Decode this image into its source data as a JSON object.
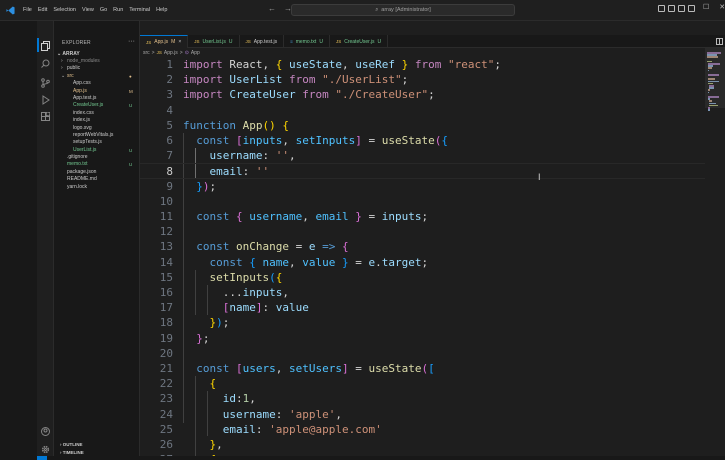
{
  "titlebar": {
    "menu": [
      "File",
      "Edit",
      "Selection",
      "View",
      "Go",
      "Run",
      "Terminal",
      "Help"
    ],
    "search_text": "array [Administrator]",
    "nav_back": "←",
    "nav_forward": "→"
  },
  "sidebar": {
    "title": "EXPLORER",
    "root": "ARRAY",
    "tree": [
      {
        "label": "node_modules",
        "indent": 1,
        "kind": "folder",
        "badge": "",
        "color": "#8a8a8a"
      },
      {
        "label": "public",
        "indent": 1,
        "kind": "folder",
        "badge": "",
        "color": "#cccccc"
      },
      {
        "label": "src",
        "indent": 1,
        "kind": "folder-open",
        "badge": "●",
        "color": "#e2c08d"
      },
      {
        "label": "App.css",
        "indent": 2,
        "kind": "file",
        "badge": "",
        "color": "#cccccc"
      },
      {
        "label": "App.js",
        "indent": 2,
        "kind": "file",
        "badge": "M",
        "color": "#e2c08d"
      },
      {
        "label": "App.test.js",
        "indent": 2,
        "kind": "file",
        "badge": "",
        "color": "#cccccc"
      },
      {
        "label": "CreateUser.js",
        "indent": 2,
        "kind": "file",
        "badge": "U",
        "color": "#73c991"
      },
      {
        "label": "index.css",
        "indent": 2,
        "kind": "file",
        "badge": "",
        "color": "#cccccc"
      },
      {
        "label": "index.js",
        "indent": 2,
        "kind": "file",
        "badge": "",
        "color": "#cccccc"
      },
      {
        "label": "logo.svg",
        "indent": 2,
        "kind": "file",
        "badge": "",
        "color": "#cccccc"
      },
      {
        "label": "reportWebVitals.js",
        "indent": 2,
        "kind": "file",
        "badge": "",
        "color": "#cccccc"
      },
      {
        "label": "setupTests.js",
        "indent": 2,
        "kind": "file",
        "badge": "",
        "color": "#cccccc"
      },
      {
        "label": "UserList.js",
        "indent": 2,
        "kind": "file",
        "badge": "U",
        "color": "#73c991"
      },
      {
        "label": ".gitignore",
        "indent": 1,
        "kind": "file",
        "badge": "",
        "color": "#cccccc"
      },
      {
        "label": "memo.txt",
        "indent": 1,
        "kind": "file",
        "badge": "U",
        "color": "#73c991"
      },
      {
        "label": "package.json",
        "indent": 1,
        "kind": "file",
        "badge": "",
        "color": "#cccccc"
      },
      {
        "label": "README.md",
        "indent": 1,
        "kind": "file",
        "badge": "",
        "color": "#cccccc"
      },
      {
        "label": "yarn.lock",
        "indent": 1,
        "kind": "file",
        "badge": "",
        "color": "#cccccc"
      }
    ],
    "outline": "OUTLINE",
    "timeline": "TIMELINE"
  },
  "tabs": [
    {
      "label": "App.js",
      "status": "M",
      "icon": "JS",
      "active": true,
      "color": "#e2c08d"
    },
    {
      "label": "UserList.js",
      "status": "U",
      "icon": "JS",
      "active": false,
      "color": "#73c991"
    },
    {
      "label": "App.test.js",
      "status": "",
      "icon": "JS",
      "active": false,
      "color": "#cccccc"
    },
    {
      "label": "memo.txt",
      "status": "U",
      "icon": "≡",
      "active": false,
      "color": "#73c991"
    },
    {
      "label": "CreateUser.js",
      "status": "U",
      "icon": "JS",
      "active": false,
      "color": "#73c991"
    }
  ],
  "breadcrumb": {
    "folder": "src",
    "sep": ">",
    "file": "App.js",
    "symbol": "App"
  },
  "editor": {
    "current_line": 8,
    "lines": [
      {
        "n": "1",
        "tokens": [
          [
            "kw2",
            "import"
          ],
          [
            "pl",
            " React, "
          ],
          [
            "b1",
            "{"
          ],
          [
            "pl",
            " "
          ],
          [
            "var",
            "useState"
          ],
          [
            "pl",
            ", "
          ],
          [
            "var",
            "useRef"
          ],
          [
            "pl",
            " "
          ],
          [
            "b1",
            "}"
          ],
          [
            "pl",
            " "
          ],
          [
            "kw2",
            "from"
          ],
          [
            "pl",
            " "
          ],
          [
            "str",
            "\"react\""
          ],
          [
            "pl",
            ";"
          ]
        ]
      },
      {
        "n": "2",
        "tokens": [
          [
            "kw2",
            "import"
          ],
          [
            "pl",
            " "
          ],
          [
            "var",
            "UserList"
          ],
          [
            "pl",
            " "
          ],
          [
            "kw2",
            "from"
          ],
          [
            "pl",
            " "
          ],
          [
            "str",
            "\"./UserList\""
          ],
          [
            "pl",
            ";"
          ]
        ]
      },
      {
        "n": "3",
        "tokens": [
          [
            "kw2",
            "import"
          ],
          [
            "pl",
            " "
          ],
          [
            "var",
            "CreateUser"
          ],
          [
            "pl",
            " "
          ],
          [
            "kw2",
            "from"
          ],
          [
            "pl",
            " "
          ],
          [
            "str",
            "\"./CreateUser\""
          ],
          [
            "pl",
            ";"
          ]
        ]
      },
      {
        "n": "4",
        "tokens": []
      },
      {
        "n": "5",
        "tokens": [
          [
            "kw",
            "function"
          ],
          [
            "pl",
            " "
          ],
          [
            "fn",
            "App"
          ],
          [
            "b1",
            "()"
          ],
          [
            "pl",
            " "
          ],
          [
            "b1",
            "{"
          ]
        ]
      },
      {
        "n": "6",
        "tokens": [
          [
            "pl",
            "  "
          ],
          [
            "kw",
            "const"
          ],
          [
            "pl",
            " "
          ],
          [
            "b2",
            "["
          ],
          [
            "cst",
            "inputs"
          ],
          [
            "pl",
            ", "
          ],
          [
            "cst",
            "setInputs"
          ],
          [
            "b2",
            "]"
          ],
          [
            "pl",
            " = "
          ],
          [
            "fn",
            "useState"
          ],
          [
            "b2",
            "("
          ],
          [
            "b3",
            "{"
          ]
        ]
      },
      {
        "n": "7",
        "tokens": [
          [
            "pl",
            "    "
          ],
          [
            "var",
            "username"
          ],
          [
            "pl",
            ": "
          ],
          [
            "str",
            "''"
          ],
          [
            "pl",
            ","
          ]
        ]
      },
      {
        "n": "8",
        "tokens": [
          [
            "pl",
            "    "
          ],
          [
            "var",
            "email"
          ],
          [
            "pl",
            ": "
          ],
          [
            "str",
            "''"
          ]
        ]
      },
      {
        "n": "9",
        "tokens": [
          [
            "pl",
            "  "
          ],
          [
            "b3",
            "}"
          ],
          [
            "b2",
            ")"
          ],
          [
            "pl",
            ";"
          ]
        ]
      },
      {
        "n": "10",
        "tokens": []
      },
      {
        "n": "11",
        "tokens": [
          [
            "pl",
            "  "
          ],
          [
            "kw",
            "const"
          ],
          [
            "pl",
            " "
          ],
          [
            "b2",
            "{"
          ],
          [
            "pl",
            " "
          ],
          [
            "cst",
            "username"
          ],
          [
            "pl",
            ", "
          ],
          [
            "cst",
            "email"
          ],
          [
            "pl",
            " "
          ],
          [
            "b2",
            "}"
          ],
          [
            "pl",
            " = "
          ],
          [
            "var",
            "inputs"
          ],
          [
            "pl",
            ";"
          ]
        ]
      },
      {
        "n": "12",
        "tokens": []
      },
      {
        "n": "13",
        "tokens": [
          [
            "pl",
            "  "
          ],
          [
            "kw",
            "const"
          ],
          [
            "pl",
            " "
          ],
          [
            "fn",
            "onChange"
          ],
          [
            "pl",
            " = "
          ],
          [
            "var",
            "e"
          ],
          [
            "pl",
            " "
          ],
          [
            "kw",
            "=>"
          ],
          [
            "pl",
            " "
          ],
          [
            "b2",
            "{"
          ]
        ]
      },
      {
        "n": "14",
        "tokens": [
          [
            "pl",
            "    "
          ],
          [
            "kw",
            "const"
          ],
          [
            "pl",
            " "
          ],
          [
            "b3",
            "{"
          ],
          [
            "pl",
            " "
          ],
          [
            "cst",
            "name"
          ],
          [
            "pl",
            ", "
          ],
          [
            "cst",
            "value"
          ],
          [
            "pl",
            " "
          ],
          [
            "b3",
            "}"
          ],
          [
            "pl",
            " = "
          ],
          [
            "var",
            "e"
          ],
          [
            "pl",
            "."
          ],
          [
            "var",
            "target"
          ],
          [
            "pl",
            ";"
          ]
        ]
      },
      {
        "n": "15",
        "tokens": [
          [
            "pl",
            "    "
          ],
          [
            "fn",
            "setInputs"
          ],
          [
            "b3",
            "("
          ],
          [
            "b1",
            "{"
          ]
        ]
      },
      {
        "n": "16",
        "tokens": [
          [
            "pl",
            "      ..."
          ],
          [
            "var",
            "inputs"
          ],
          [
            "pl",
            ","
          ]
        ]
      },
      {
        "n": "17",
        "tokens": [
          [
            "pl",
            "      "
          ],
          [
            "b2",
            "["
          ],
          [
            "var",
            "name"
          ],
          [
            "b2",
            "]"
          ],
          [
            "pl",
            ": "
          ],
          [
            "var",
            "value"
          ]
        ]
      },
      {
        "n": "18",
        "tokens": [
          [
            "pl",
            "    "
          ],
          [
            "b1",
            "}"
          ],
          [
            "b3",
            ")"
          ],
          [
            "pl",
            ";"
          ]
        ]
      },
      {
        "n": "19",
        "tokens": [
          [
            "pl",
            "  "
          ],
          [
            "b2",
            "}"
          ],
          [
            "pl",
            ";"
          ]
        ]
      },
      {
        "n": "20",
        "tokens": []
      },
      {
        "n": "21",
        "tokens": [
          [
            "pl",
            "  "
          ],
          [
            "kw",
            "const"
          ],
          [
            "pl",
            " "
          ],
          [
            "b2",
            "["
          ],
          [
            "cst",
            "users"
          ],
          [
            "pl",
            ", "
          ],
          [
            "cst",
            "setUsers"
          ],
          [
            "b2",
            "]"
          ],
          [
            "pl",
            " = "
          ],
          [
            "fn",
            "useState"
          ],
          [
            "b2",
            "("
          ],
          [
            "b3",
            "["
          ]
        ]
      },
      {
        "n": "22",
        "tokens": [
          [
            "pl",
            "    "
          ],
          [
            "b1",
            "{"
          ]
        ]
      },
      {
        "n": "23",
        "tokens": [
          [
            "pl",
            "      "
          ],
          [
            "var",
            "id"
          ],
          [
            "pl",
            ":"
          ],
          [
            "num",
            "1"
          ],
          [
            "pl",
            ","
          ]
        ]
      },
      {
        "n": "24",
        "tokens": [
          [
            "pl",
            "      "
          ],
          [
            "var",
            "username"
          ],
          [
            "pl",
            ": "
          ],
          [
            "str",
            "'apple'"
          ],
          [
            "pl",
            ","
          ]
        ]
      },
      {
        "n": "25",
        "tokens": [
          [
            "pl",
            "      "
          ],
          [
            "var",
            "email"
          ],
          [
            "pl",
            ": "
          ],
          [
            "str",
            "'apple@apple.com'"
          ]
        ]
      },
      {
        "n": "26",
        "tokens": [
          [
            "pl",
            "    "
          ],
          [
            "b1",
            "}"
          ],
          [
            "pl",
            ","
          ]
        ]
      },
      {
        "n": "27",
        "tokens": [
          [
            "pl",
            "    "
          ],
          [
            "b1",
            "{"
          ]
        ]
      }
    ]
  },
  "icons": {
    "explorer": "files-icon",
    "search": "search-icon",
    "scm": "source-control-icon",
    "debug": "run-debug-icon",
    "extensions": "extensions-icon",
    "account": "account-icon",
    "settings": "gear-icon"
  }
}
